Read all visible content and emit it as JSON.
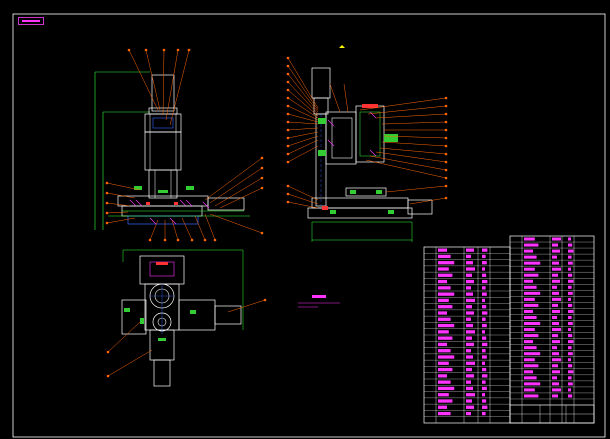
{
  "drawing": {
    "title": "",
    "sheet_color": "#000000",
    "border_color": "#ffffff",
    "colors": {
      "outline": "#ffffff",
      "leader": "#ff6600",
      "hidden": "#33cc33",
      "section": "#3366ff",
      "hatch": "#ff33ff",
      "marker": "#ffff00",
      "dimension": "#33ff33",
      "detail_lines": "#66ccff"
    },
    "views": {
      "front_view": "front-view",
      "side_view": "side-view",
      "top_view": "top-view"
    },
    "parts_list": {
      "visible": true,
      "columns": 8,
      "rows": 28
    },
    "title_block": {
      "visible": true
    }
  }
}
